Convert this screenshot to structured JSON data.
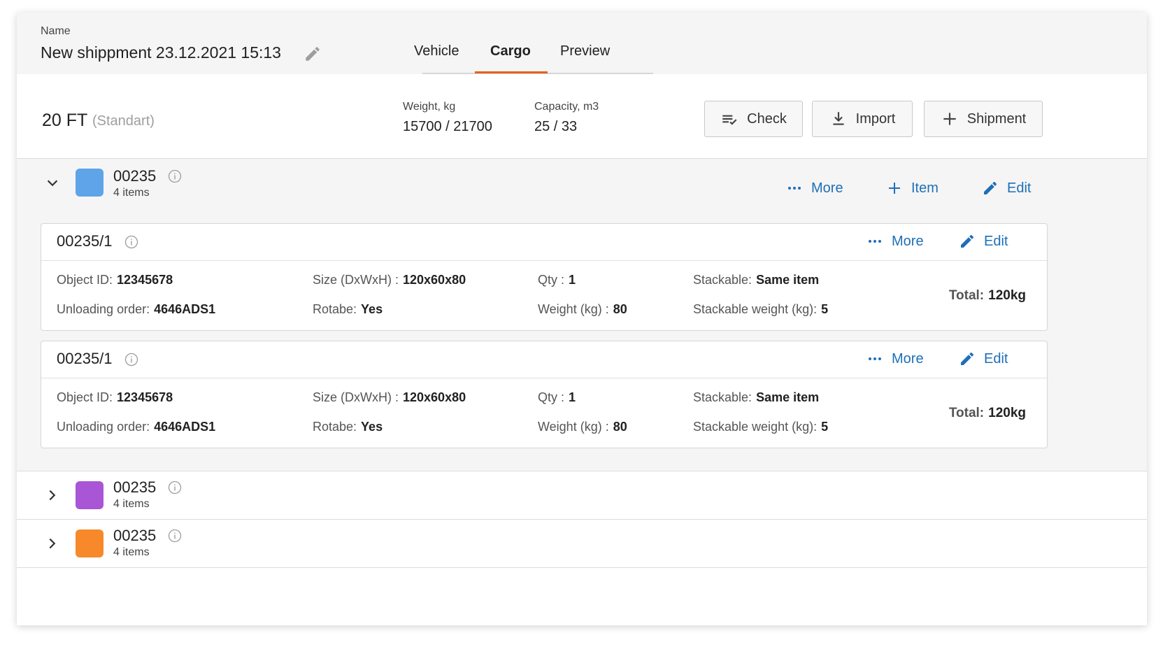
{
  "header": {
    "name_label": "Name",
    "name_value": "New shippment 23.12.2021 15:13",
    "tabs": [
      {
        "label": "Vehicle",
        "active": false
      },
      {
        "label": "Cargo",
        "active": true
      },
      {
        "label": "Preview",
        "active": false
      }
    ],
    "accent_color": "#e8601c"
  },
  "vehicle": {
    "title": "20 FT",
    "subtitle": "(Standart)",
    "weight_label": "Weight, kg",
    "weight_value": "15700 / 21700",
    "capacity_label": "Capacity, m3",
    "capacity_value": "25 / 33",
    "buttons": {
      "check": "Check",
      "import": "Import",
      "shipment": "Shipment"
    }
  },
  "groups": [
    {
      "id": "00235",
      "count": "4 items",
      "color": "#5fa4e8",
      "expanded": true,
      "actions": {
        "more": "More",
        "item": "Item",
        "edit": "Edit"
      },
      "items": [
        {
          "id": "00235/1",
          "actions": {
            "more": "More",
            "edit": "Edit"
          },
          "object_id_label": "Object ID:",
          "object_id": "12345678",
          "unloading_label": "Unloading order:",
          "unloading": "4646ADS1",
          "size_label": "Size (DxWxH) :",
          "size": "120x60x80",
          "rotabe_label": "Rotabe:",
          "rotabe": "Yes",
          "qty_label": "Qty :",
          "qty": "1",
          "weight_label": "Weight (kg) :",
          "weight": "80",
          "stackable_label": "Stackable:",
          "stackable": "Same item",
          "stack_weight_label": "Stackable weight (kg):",
          "stack_weight": "5",
          "total_label": "Total:",
          "total": "120kg"
        },
        {
          "id": "00235/1",
          "actions": {
            "more": "More",
            "edit": "Edit"
          },
          "object_id_label": "Object ID:",
          "object_id": "12345678",
          "unloading_label": "Unloading order:",
          "unloading": "4646ADS1",
          "size_label": "Size (DxWxH) :",
          "size": "120x60x80",
          "rotabe_label": "Rotabe:",
          "rotabe": "Yes",
          "qty_label": "Qty :",
          "qty": "1",
          "weight_label": "Weight (kg) :",
          "weight": "80",
          "stackable_label": "Stackable:",
          "stackable": "Same item",
          "stack_weight_label": "Stackable weight (kg):",
          "stack_weight": "5",
          "total_label": "Total:",
          "total": "120kg"
        }
      ]
    },
    {
      "id": "00235",
      "count": "4 items",
      "color": "#a855d6",
      "expanded": false
    },
    {
      "id": "00235",
      "count": "4 items",
      "color": "#f7892b",
      "expanded": false
    }
  ],
  "colors": {
    "link": "#1e6fb8"
  }
}
